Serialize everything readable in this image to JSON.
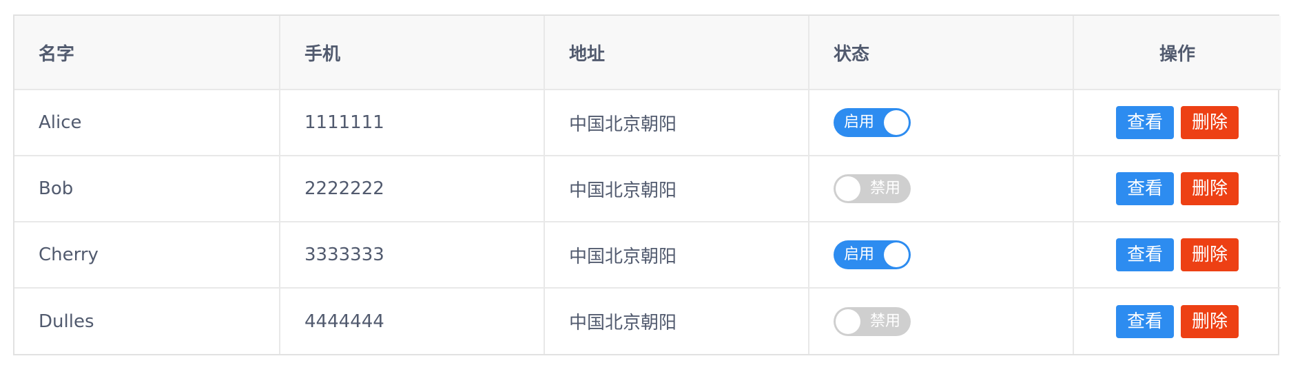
{
  "table": {
    "columns": [
      {
        "label": "名字"
      },
      {
        "label": "手机"
      },
      {
        "label": "地址"
      },
      {
        "label": "状态"
      },
      {
        "label": "操作"
      }
    ],
    "rows": [
      {
        "name": "Alice",
        "phone": "1111111",
        "address": "中国北京朝阳",
        "status": {
          "on": true,
          "label": "启用"
        },
        "view_label": "查看",
        "delete_label": "删除"
      },
      {
        "name": "Bob",
        "phone": "2222222",
        "address": "中国北京朝阳",
        "status": {
          "on": false,
          "label": "禁用"
        },
        "view_label": "查看",
        "delete_label": "删除"
      },
      {
        "name": "Cherry",
        "phone": "3333333",
        "address": "中国北京朝阳",
        "status": {
          "on": true,
          "label": "启用"
        },
        "view_label": "查看",
        "delete_label": "删除"
      },
      {
        "name": "Dulles",
        "phone": "4444444",
        "address": "中国北京朝阳",
        "status": {
          "on": false,
          "label": "禁用"
        },
        "view_label": "查看",
        "delete_label": "删除"
      }
    ]
  },
  "colors": {
    "primary": "#2d8cf0",
    "danger": "#ed4014",
    "switch_off": "#cfcfcf",
    "header_bg": "#f8f8f8",
    "text": "#515a6e"
  }
}
